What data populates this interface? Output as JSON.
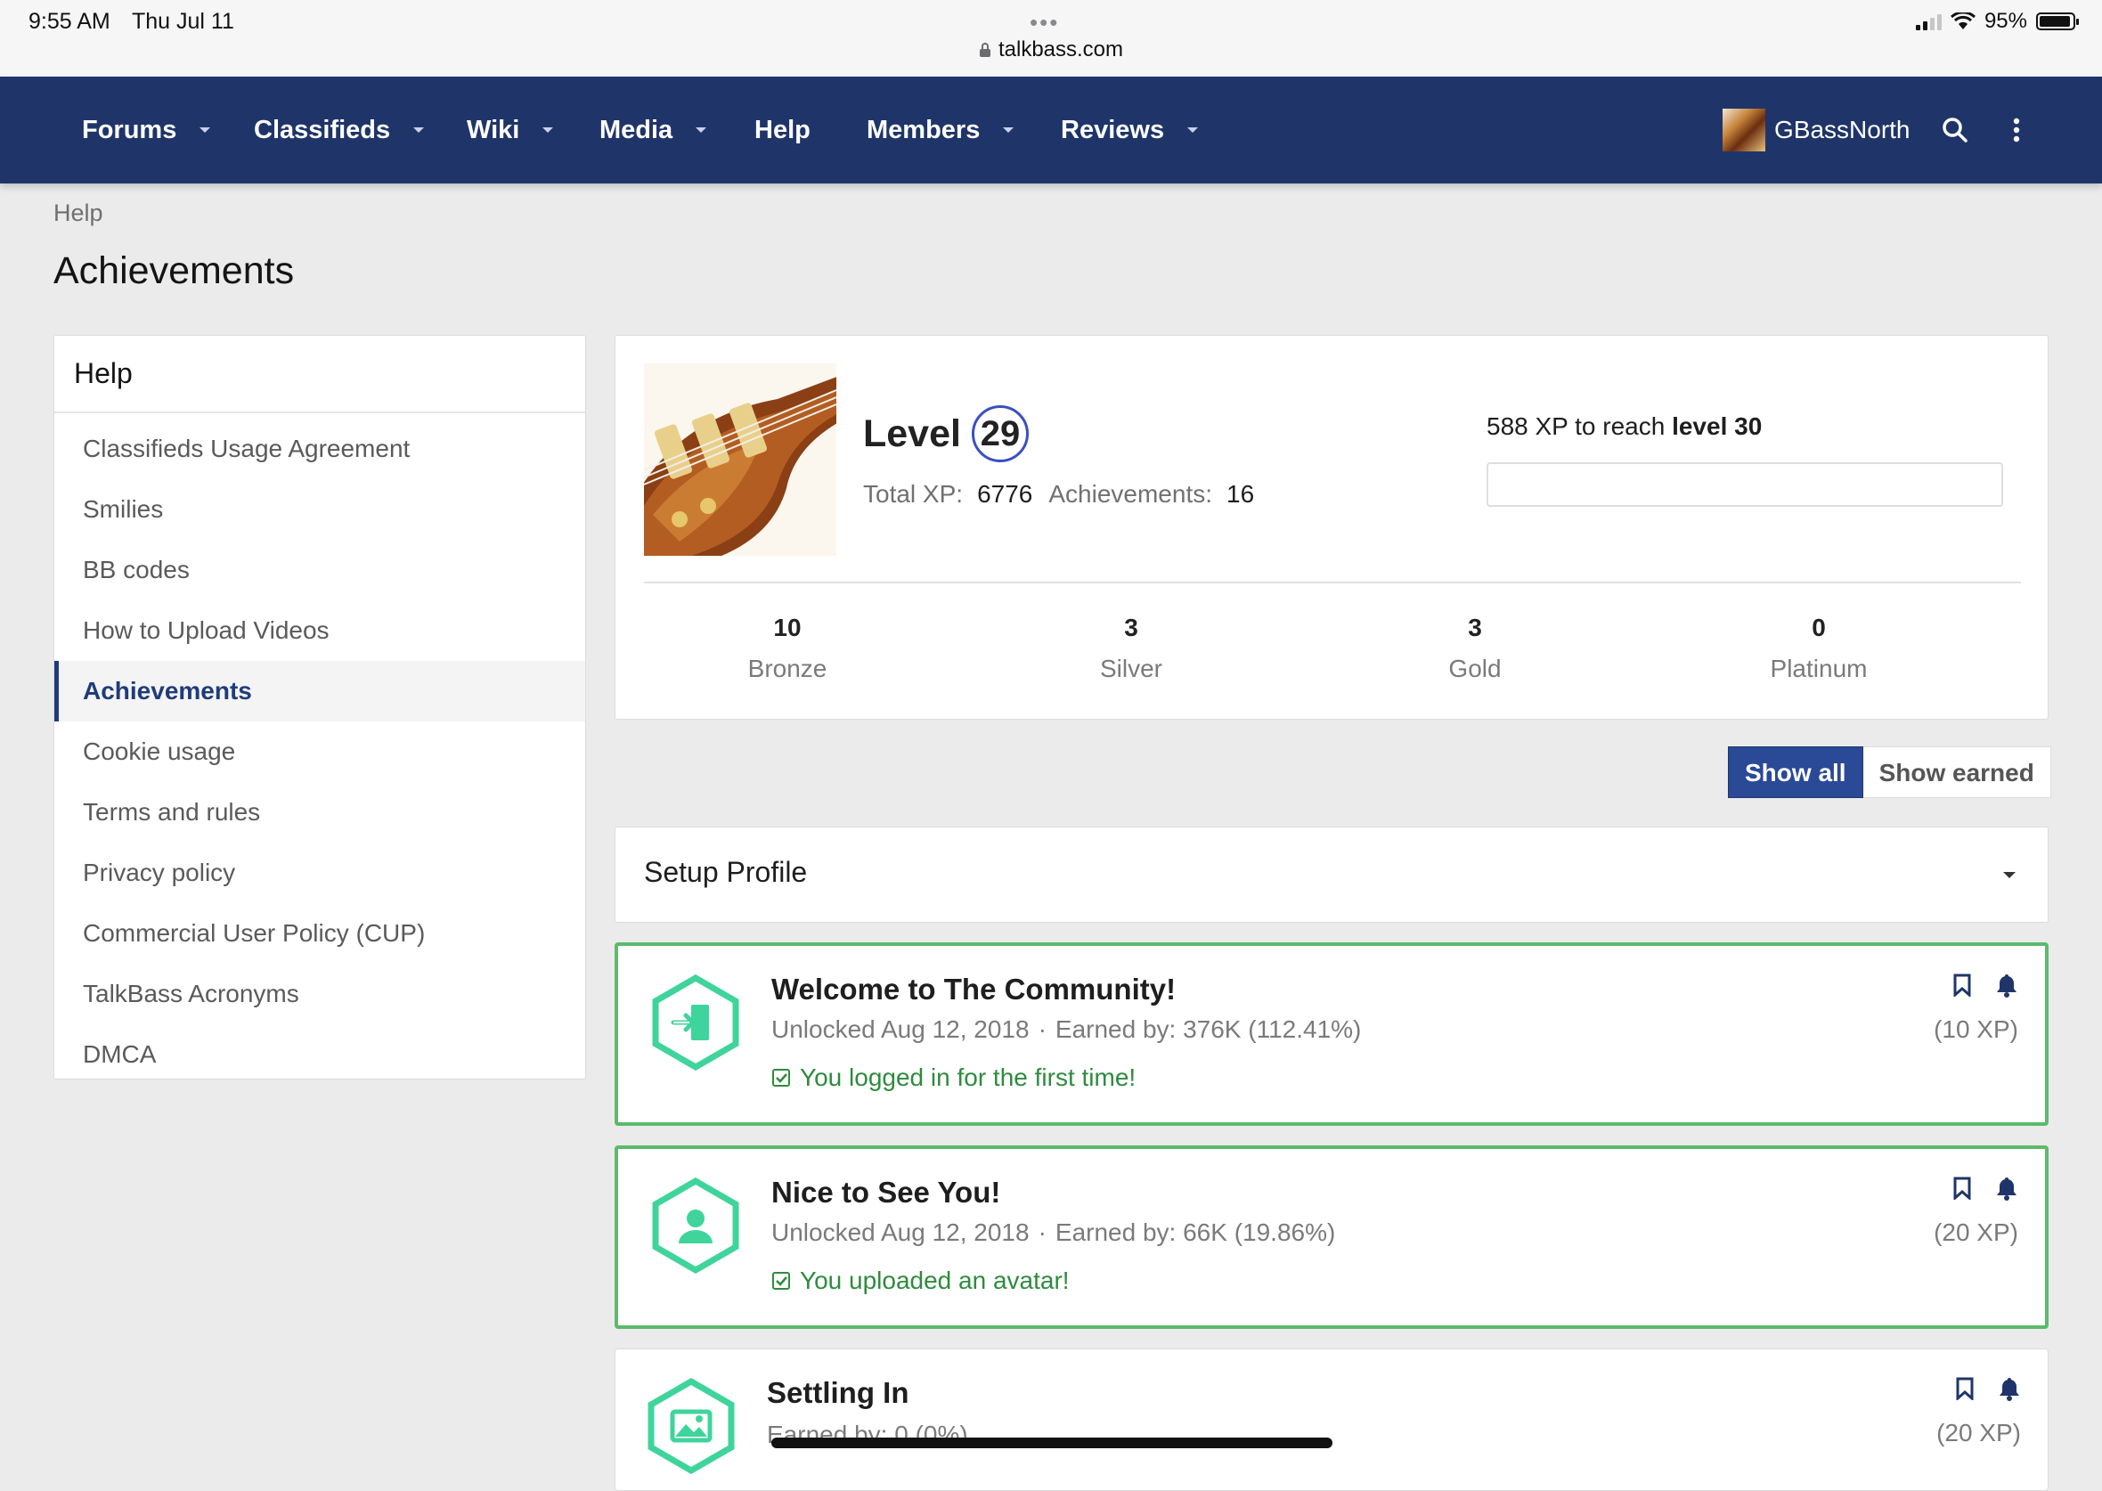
{
  "status_bar": {
    "time": "9:55 AM",
    "date": "Thu Jul 11",
    "dots": "•••",
    "url": "talkbass.com",
    "battery": "95%",
    "battery_level": 0.95
  },
  "nav": {
    "items": [
      {
        "label": "Forums",
        "has_menu": true
      },
      {
        "label": "Classifieds",
        "has_menu": true
      },
      {
        "label": "Wiki",
        "has_menu": true
      },
      {
        "label": "Media",
        "has_menu": true
      },
      {
        "label": "Help",
        "has_menu": false
      },
      {
        "label": "Members",
        "has_menu": true
      },
      {
        "label": "Reviews",
        "has_menu": true
      }
    ],
    "username": "GBassNorth",
    "search_icon": "search-icon",
    "more_icon": "vertical-ellipsis-icon"
  },
  "page": {
    "breadcrumb": "Help",
    "title": "Achievements"
  },
  "sidebar": {
    "heading": "Help",
    "items": [
      {
        "label": "Classifieds Usage Agreement",
        "active": false
      },
      {
        "label": "Smilies",
        "active": false
      },
      {
        "label": "BB codes",
        "active": false
      },
      {
        "label": "How to Upload Videos",
        "active": false
      },
      {
        "label": "Achievements",
        "active": true
      },
      {
        "label": "Cookie usage",
        "active": false
      },
      {
        "label": "Terms and rules",
        "active": false
      },
      {
        "label": "Privacy policy",
        "active": false
      },
      {
        "label": "Commercial User Policy (CUP)",
        "active": false
      },
      {
        "label": "TalkBass Acronyms",
        "active": false
      },
      {
        "label": "DMCA",
        "active": false
      }
    ]
  },
  "summary": {
    "level_label": "Level",
    "level": "29",
    "total_xp_label": "Total XP:",
    "total_xp": "6776",
    "achievements_label": "Achievements:",
    "achievements": "16",
    "xp_to_next_prefix": "588 XP to reach",
    "xp_to_next_level": "level 30",
    "progress_fraction": 0,
    "medals": [
      {
        "count": "10",
        "label": "Bronze"
      },
      {
        "count": "3",
        "label": "Silver"
      },
      {
        "count": "3",
        "label": "Gold"
      },
      {
        "count": "0",
        "label": "Platinum"
      }
    ]
  },
  "filters": {
    "show_all": "Show all",
    "show_earned": "Show earned"
  },
  "category": {
    "label": "Setup Profile"
  },
  "achievements": [
    {
      "title": "Welcome to The Community!",
      "unlocked": "Unlocked Aug 12, 2018",
      "earned_by": "Earned by: 376K (112.41%)",
      "done_text": "You logged in for the first time!",
      "xp": "(10 XP)",
      "icon": "sign-in-icon",
      "earned": true
    },
    {
      "title": "Nice to See You!",
      "unlocked": "Unlocked Aug 12, 2018",
      "earned_by": "Earned by: 66K (19.86%)",
      "done_text": "You uploaded an avatar!",
      "xp": "(20 XP)",
      "icon": "user-icon",
      "earned": true
    },
    {
      "title": "Settling In",
      "unlocked": "",
      "earned_by": "Earned by: 0 (0%)",
      "done_text": "",
      "xp": "(20 XP)",
      "icon": "image-icon",
      "earned": false
    }
  ],
  "colors": {
    "nav_bg": "#1f3569",
    "accent": "#2a4a97",
    "earned_border": "#5cba6b",
    "hex_icon": "#3fd49b",
    "done_text": "#2e8b3e",
    "level_ring": "#3a4fc0"
  }
}
